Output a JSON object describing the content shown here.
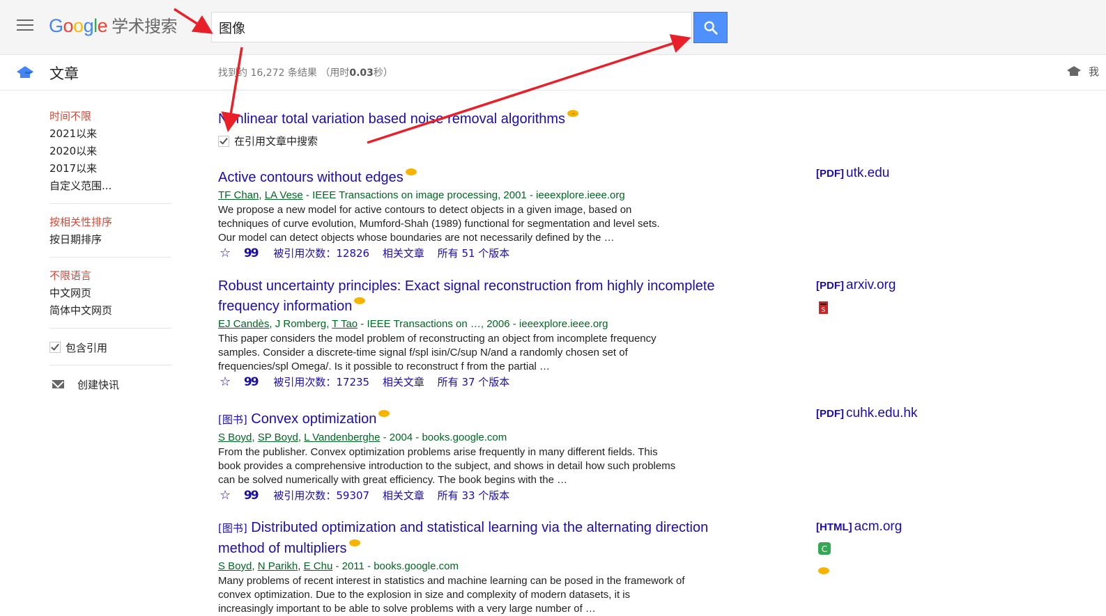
{
  "header": {
    "logo_letters": [
      "G",
      "o",
      "o",
      "g",
      "l",
      "e"
    ],
    "logo_subtitle": "学术搜索",
    "search_value": "图像",
    "menu_icon": "hamburger-menu-icon",
    "search_icon": "search-icon",
    "search_button_color": "#4d90fe"
  },
  "subheader": {
    "section_title": "文章",
    "result_count_prefix": "找到约 16,272 条结果 （用时",
    "result_time": "0.03",
    "result_count_suffix": "秒）",
    "my_library_partial": "我"
  },
  "sidebar": {
    "time_filters": [
      "时间不限",
      "2021以来",
      "2020以来",
      "2017以来",
      "自定义范围..."
    ],
    "sort_options": [
      "按相关性排序",
      "按日期排序"
    ],
    "language_options": [
      "不限语言",
      "中文网页",
      "简体中文网页"
    ],
    "include_citations": "包含引用",
    "create_alert": "创建快讯",
    "active_color": "#d14836"
  },
  "cited_search": {
    "title": "Nonlinear total variation based noise removal algorithms",
    "checkbox_label": "在引用文章中搜索"
  },
  "results": [
    {
      "kind": "",
      "title": "Active contours without edges",
      "authors": [
        "TF Chan",
        "LA Vese"
      ],
      "source": " - IEEE Transactions on image processing, 2001 - ieeexplore.ieee.org",
      "snippet": "We propose a new model for active contours to detect objects in a given image, based on techniques of curve evolution, Mumford-Shah (1989) functional for segmentation and level sets. Our model can detect objects whose boundaries are not necessarily defined by the …",
      "cited_by": "被引用次数：12826",
      "related": "相关文章",
      "versions": "所有 51 个版本",
      "side_tag": "[PDF]",
      "side_domain": "utk.edu"
    },
    {
      "kind": "",
      "title": "Robust uncertainty principles: Exact signal reconstruction from highly incomplete frequency information",
      "authors": [
        "EJ Candès",
        "J Romberg",
        "T Tao"
      ],
      "source": " - IEEE Transactions on …, 2006 - ieeexplore.ieee.org",
      "snippet": "This paper considers the model problem of reconstructing an object from incomplete frequency samples. Consider a discrete-time signal f/spl isin/C/sup N/and a randomly chosen set of frequencies/spl Omega/. Is it possible to reconstruct f from the partial …",
      "cited_by": "被引用次数：17235",
      "related": "相关文章",
      "versions": "所有 37 个版本",
      "side_tag": "[PDF]",
      "side_domain": "arxiv.org"
    },
    {
      "kind": "[图书]",
      "title": "Convex optimization",
      "authors": [
        "S Boyd",
        "SP Boyd",
        "L Vandenberghe"
      ],
      "source": " - 2004 - books.google.com",
      "snippet": "From the publisher. Convex optimization problems arise frequently in many different fields. This book provides a comprehensive introduction to the subject, and shows in detail how such problems can be solved numerically with great efficiency. The book begins with the …",
      "cited_by": "被引用次数：59307",
      "related": "相关文章",
      "versions": "所有 33 个版本",
      "side_tag": "[PDF]",
      "side_domain": "cuhk.edu.hk"
    },
    {
      "kind": "[图书]",
      "title": "Distributed optimization and statistical learning via the alternating direction method of multipliers",
      "authors": [
        "S Boyd",
        "N Parikh",
        "E Chu"
      ],
      "source": " - 2011 - books.google.com",
      "snippet": "Many problems of recent interest in statistics and machine learning can be posed in the framework of convex optimization. Due to the explosion in size and complexity of modern datasets, it is increasingly important to be able to solve problems with a very large number of …",
      "side_tag": "[HTML]",
      "side_domain": "acm.org"
    }
  ],
  "colors": {
    "link": "#1a0dab",
    "meta_green": "#006621",
    "annotation_red": "#e8202a"
  }
}
